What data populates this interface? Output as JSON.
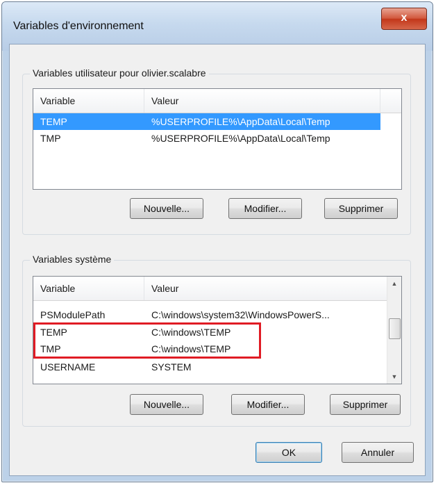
{
  "window": {
    "title": "Variables d'environnement",
    "close_glyph": "x"
  },
  "user_group": {
    "label": "Variables utilisateur pour olivier.scalabre",
    "columns": [
      "Variable",
      "Valeur"
    ],
    "rows": [
      {
        "variable": "TEMP",
        "value": "%USERPROFILE%\\AppData\\Local\\Temp",
        "selected": true
      },
      {
        "variable": "TMP",
        "value": "%USERPROFILE%\\AppData\\Local\\Temp",
        "selected": false
      }
    ],
    "buttons": {
      "new": "Nouvelle...",
      "edit": "Modifier...",
      "delete": "Supprimer"
    }
  },
  "system_group": {
    "label": "Variables système",
    "columns": [
      "Variable",
      "Valeur"
    ],
    "rows": [
      {
        "variable": "PSModulePath",
        "value": "C:\\windows\\system32\\WindowsPowerS..."
      },
      {
        "variable": "TEMP",
        "value": "C:\\windows\\TEMP"
      },
      {
        "variable": "TMP",
        "value": "C:\\windows\\TEMP"
      },
      {
        "variable": "USERNAME",
        "value": "SYSTEM"
      }
    ],
    "buttons": {
      "new": "Nouvelle...",
      "edit": "Modifier...",
      "delete": "Supprimer"
    }
  },
  "footer": {
    "ok": "OK",
    "cancel": "Annuler"
  },
  "colors": {
    "selection": "#3399ff",
    "highlight_box": "#e01b24",
    "close_button": "#c2371a"
  }
}
